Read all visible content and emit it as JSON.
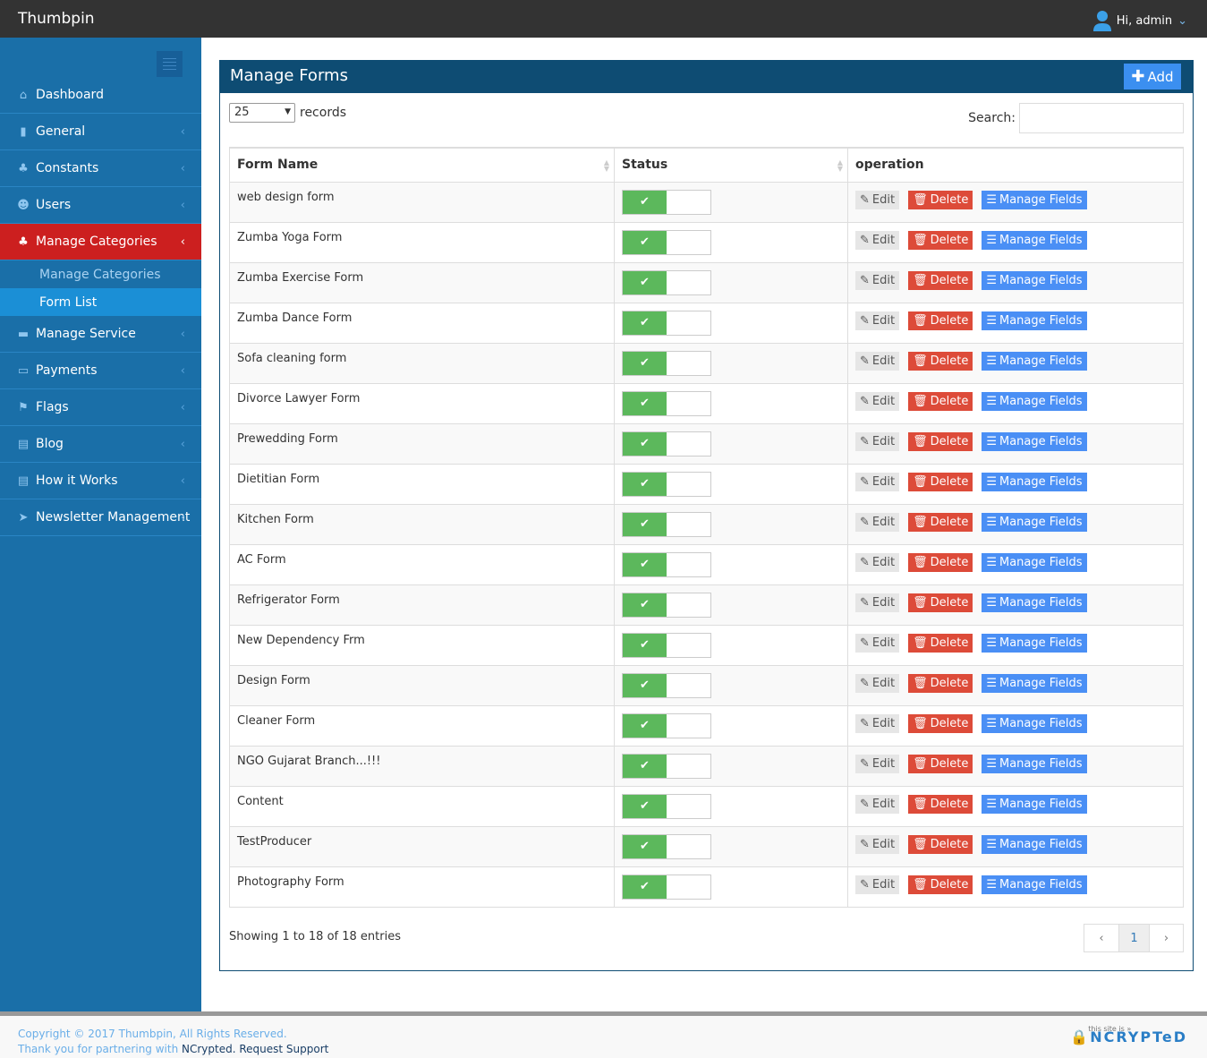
{
  "app": {
    "title": "Thumbpin",
    "user_greeting": "Hi, admin"
  },
  "sidebar": {
    "items": [
      {
        "label": "Dashboard",
        "icon": "home-icon",
        "chevron": false
      },
      {
        "label": "General",
        "icon": "file-icon",
        "chevron": true
      },
      {
        "label": "Constants",
        "icon": "sitemap-icon",
        "chevron": true
      },
      {
        "label": "Users",
        "icon": "users-icon",
        "chevron": true
      },
      {
        "label": "Manage Categories",
        "icon": "sitemap-icon",
        "chevron": true,
        "active": true
      },
      {
        "label": "Manage Service",
        "icon": "briefcase-icon",
        "chevron": true
      },
      {
        "label": "Payments",
        "icon": "money-icon",
        "chevron": true
      },
      {
        "label": "Flags",
        "icon": "flag-icon",
        "chevron": true
      },
      {
        "label": "Blog",
        "icon": "book-icon",
        "chevron": true
      },
      {
        "label": "How it Works",
        "icon": "book-icon",
        "chevron": true
      },
      {
        "label": "Newsletter Management",
        "icon": "paper-plane-icon",
        "chevron": true
      }
    ],
    "submenu": [
      {
        "label": "Manage Categories"
      },
      {
        "label": "Form List",
        "current": true
      }
    ]
  },
  "panel": {
    "title": "Manage Forms",
    "add_label": "Add",
    "length_value": "25",
    "length_suffix": "records",
    "search_label": "Search:",
    "search_value": ""
  },
  "table": {
    "columns": [
      "Form Name",
      "Status",
      "operation"
    ],
    "rows": [
      "web design form",
      "Zumba Yoga Form",
      "Zumba Exercise Form",
      "Zumba Dance Form",
      "Sofa cleaning form",
      "Divorce Lawyer Form",
      "Prewedding Form",
      "Dietitian Form",
      "Kitchen Form",
      "AC Form",
      "Refrigerator Form",
      "New Dependency Frm",
      "Design Form",
      "Cleaner Form",
      "NGO Gujarat Branch...!!!",
      "Content",
      "TestProducer",
      "Photography Form"
    ],
    "status_on": true,
    "actions": {
      "edit": "Edit",
      "delete": "Delete",
      "manage": "Manage Fields"
    }
  },
  "pagination": {
    "info": "Showing 1 to 18 of 18 entries",
    "prev": "‹",
    "current": "1",
    "next": "›"
  },
  "footer": {
    "copyright": "Copyright © 2017 Thumbpin, All Rights Reserved.",
    "partner_prefix": "Thank you for partnering with ",
    "partner_name": "NCrypted",
    "separator": ". ",
    "support": "Request Support",
    "logo_text": "NCRYPTeD",
    "logo_tag": "this site is »"
  },
  "colors": {
    "sidebar": "#1a6fa8",
    "active": "#cc1f1f",
    "panel_header": "#0e4c73",
    "toggle_on": "#5cb85c",
    "delete": "#dd4b39",
    "manage": "#4a8ff5"
  }
}
